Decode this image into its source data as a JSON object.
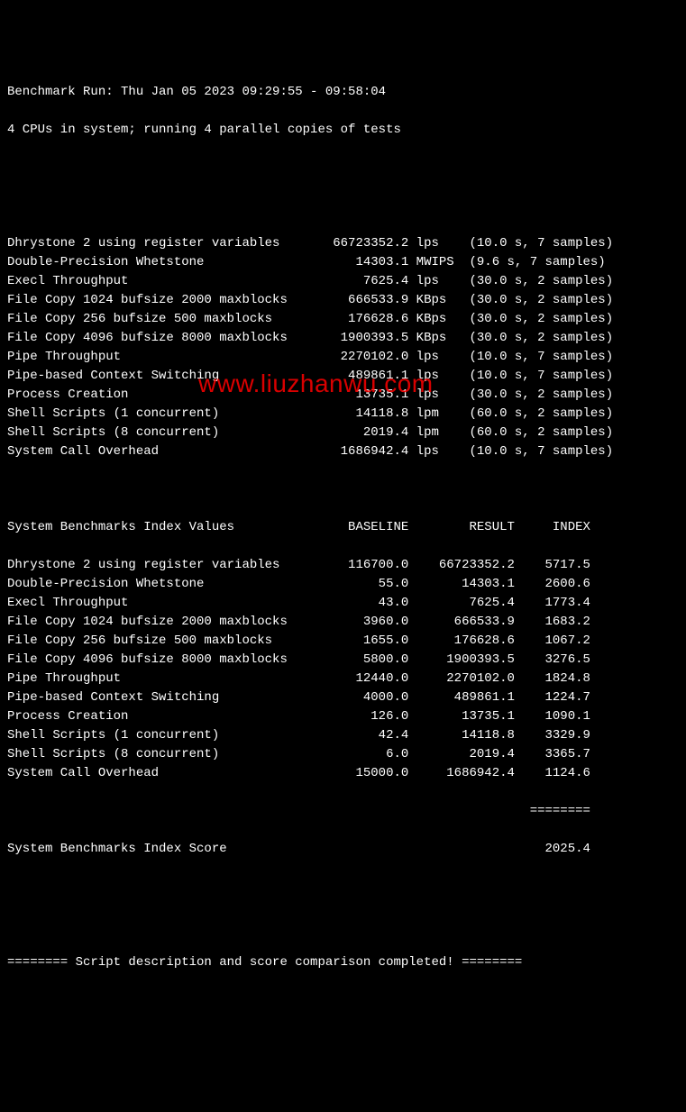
{
  "header": {
    "line1": "Benchmark Run: Thu Jan 05 2023 09:29:55 - 09:58:04",
    "line2": "4 CPUs in system; running 4 parallel copies of tests"
  },
  "results": [
    {
      "name": "Dhrystone 2 using register variables",
      "value": "66723352.2",
      "unit": "lps",
      "timing": "(10.0 s, 7 samples)"
    },
    {
      "name": "Double-Precision Whetstone",
      "value": "14303.1",
      "unit": "MWIPS",
      "timing": "(9.6 s, 7 samples)"
    },
    {
      "name": "Execl Throughput",
      "value": "7625.4",
      "unit": "lps",
      "timing": "(30.0 s, 2 samples)"
    },
    {
      "name": "File Copy 1024 bufsize 2000 maxblocks",
      "value": "666533.9",
      "unit": "KBps",
      "timing": "(30.0 s, 2 samples)"
    },
    {
      "name": "File Copy 256 bufsize 500 maxblocks",
      "value": "176628.6",
      "unit": "KBps",
      "timing": "(30.0 s, 2 samples)"
    },
    {
      "name": "File Copy 4096 bufsize 8000 maxblocks",
      "value": "1900393.5",
      "unit": "KBps",
      "timing": "(30.0 s, 2 samples)"
    },
    {
      "name": "Pipe Throughput",
      "value": "2270102.0",
      "unit": "lps",
      "timing": "(10.0 s, 7 samples)"
    },
    {
      "name": "Pipe-based Context Switching",
      "value": "489861.1",
      "unit": "lps",
      "timing": "(10.0 s, 7 samples)"
    },
    {
      "name": "Process Creation",
      "value": "13735.1",
      "unit": "lps",
      "timing": "(30.0 s, 2 samples)"
    },
    {
      "name": "Shell Scripts (1 concurrent)",
      "value": "14118.8",
      "unit": "lpm",
      "timing": "(60.0 s, 2 samples)"
    },
    {
      "name": "Shell Scripts (8 concurrent)",
      "value": "2019.4",
      "unit": "lpm",
      "timing": "(60.0 s, 2 samples)"
    },
    {
      "name": "System Call Overhead",
      "value": "1686942.4",
      "unit": "lps",
      "timing": "(10.0 s, 7 samples)"
    }
  ],
  "index_header": {
    "title": "System Benchmarks Index Values",
    "col1": "BASELINE",
    "col2": "RESULT",
    "col3": "INDEX"
  },
  "index_rows": [
    {
      "name": "Dhrystone 2 using register variables",
      "baseline": "116700.0",
      "result": "66723352.2",
      "index": "5717.5"
    },
    {
      "name": "Double-Precision Whetstone",
      "baseline": "55.0",
      "result": "14303.1",
      "index": "2600.6"
    },
    {
      "name": "Execl Throughput",
      "baseline": "43.0",
      "result": "7625.4",
      "index": "1773.4"
    },
    {
      "name": "File Copy 1024 bufsize 2000 maxblocks",
      "baseline": "3960.0",
      "result": "666533.9",
      "index": "1683.2"
    },
    {
      "name": "File Copy 256 bufsize 500 maxblocks",
      "baseline": "1655.0",
      "result": "176628.6",
      "index": "1067.2"
    },
    {
      "name": "File Copy 4096 bufsize 8000 maxblocks",
      "baseline": "5800.0",
      "result": "1900393.5",
      "index": "3276.5"
    },
    {
      "name": "Pipe Throughput",
      "baseline": "12440.0",
      "result": "2270102.0",
      "index": "1824.8"
    },
    {
      "name": "Pipe-based Context Switching",
      "baseline": "4000.0",
      "result": "489861.1",
      "index": "1224.7"
    },
    {
      "name": "Process Creation",
      "baseline": "126.0",
      "result": "13735.1",
      "index": "1090.1"
    },
    {
      "name": "Shell Scripts (1 concurrent)",
      "baseline": "42.4",
      "result": "14118.8",
      "index": "3329.9"
    },
    {
      "name": "Shell Scripts (8 concurrent)",
      "baseline": "6.0",
      "result": "2019.4",
      "index": "3365.7"
    },
    {
      "name": "System Call Overhead",
      "baseline": "15000.0",
      "result": "1686942.4",
      "index": "1124.6"
    }
  ],
  "score": {
    "label": "System Benchmarks Index Score",
    "value": "2025.4",
    "divider": "========"
  },
  "footer": "======== Script description and score comparison completed! ========",
  "watermark": "www.liuzhanwu.com"
}
